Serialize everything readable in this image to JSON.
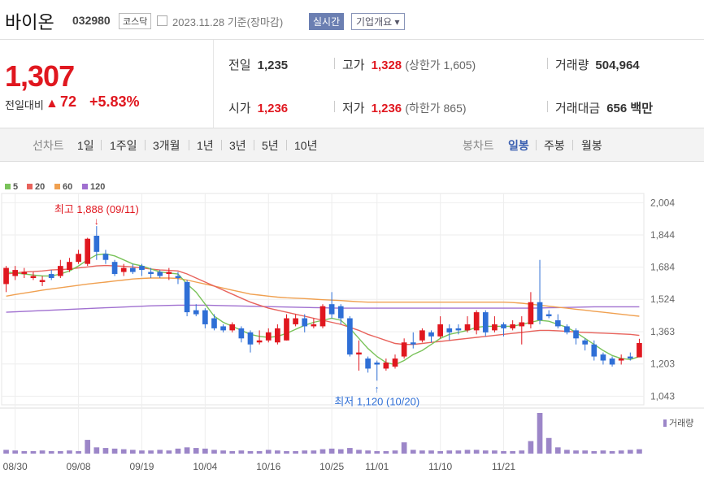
{
  "header": {
    "name": "바이온",
    "code": "032980",
    "market": "코스닥",
    "date": "2023.11.28 기준(장마감)",
    "realtime": "실시간",
    "overview": "기업개요"
  },
  "price": {
    "current": "1,307",
    "change_label": "전일대비",
    "change_value": "72",
    "change_pct": "+5.83%",
    "arrow": "▲"
  },
  "stats": {
    "prev_label": "전일",
    "prev": "1,235",
    "high_label": "고가",
    "high": "1,328",
    "upper_limit": "(상한가 1,605)",
    "volume_label": "거래량",
    "volume": "504,964",
    "open_label": "시가",
    "open": "1,236",
    "low_label": "저가",
    "low": "1,236",
    "lower_limit": "(하한가 865)",
    "amount_label": "거래대금",
    "amount": "656 백만"
  },
  "nav": {
    "line_label": "선차트",
    "periods": [
      "1일",
      "1주일",
      "3개월",
      "1년",
      "3년",
      "5년",
      "10년"
    ],
    "candle_label": "봉차트",
    "candles": [
      "일봉",
      "주봉",
      "월봉"
    ],
    "active_candle": "일봉"
  },
  "colors": {
    "up": "#e0171f",
    "down": "#2f6fd6",
    "ma5": "#7ac35a",
    "ma20": "#e8635c",
    "ma60": "#f0a050",
    "ma120": "#a070d0",
    "volume": "#9c86c8"
  },
  "chart_data": {
    "type": "candlestick",
    "legend": [
      {
        "name": "5",
        "color": "#7ac35a"
      },
      {
        "name": "20",
        "color": "#e8635c"
      },
      {
        "name": "60",
        "color": "#f0a050"
      },
      {
        "name": "120",
        "color": "#a070d0"
      }
    ],
    "ylim": [
      1000,
      2050
    ],
    "yticks": [
      "2,004",
      "1,844",
      "1,684",
      "1,524",
      "1,363",
      "1,203",
      "1,043"
    ],
    "ytick_values": [
      2004,
      1844,
      1684,
      1524,
      1363,
      1203,
      1043
    ],
    "xtick_labels": [
      "08/30",
      "09/08",
      "09/19",
      "10/04",
      "10/16",
      "10/25",
      "11/01",
      "11/10",
      "11/21"
    ],
    "xtick_index": [
      1,
      8,
      15,
      22,
      29,
      36,
      41,
      48,
      55
    ],
    "annotations": {
      "high": "최고 1,888 (09/11)",
      "low": "최저 1,120 (10/20)"
    },
    "volume_label": "거래량",
    "candles": [
      [
        1600,
        1680,
        1560,
        1690
      ],
      [
        1640,
        1670,
        1620,
        1690
      ],
      [
        1650,
        1660,
        1630,
        1680
      ],
      [
        1630,
        1640,
        1620,
        1660
      ],
      [
        1610,
        1620,
        1590,
        1640
      ],
      [
        1650,
        1630,
        1620,
        1670
      ],
      [
        1640,
        1690,
        1630,
        1720
      ],
      [
        1670,
        1710,
        1660,
        1730
      ],
      [
        1710,
        1750,
        1700,
        1770
      ],
      [
        1700,
        1825,
        1690,
        1830
      ],
      [
        1840,
        1760,
        1720,
        1888
      ],
      [
        1750,
        1720,
        1700,
        1770
      ],
      [
        1710,
        1650,
        1640,
        1720
      ],
      [
        1660,
        1680,
        1640,
        1700
      ],
      [
        1680,
        1660,
        1650,
        1700
      ],
      [
        1690,
        1670,
        1640,
        1700
      ],
      [
        1660,
        1650,
        1630,
        1680
      ],
      [
        1660,
        1640,
        1630,
        1670
      ],
      [
        1650,
        1660,
        1620,
        1680
      ],
      [
        1640,
        1630,
        1600,
        1660
      ],
      [
        1610,
        1460,
        1440,
        1620
      ],
      [
        1470,
        1450,
        1440,
        1500
      ],
      [
        1470,
        1400,
        1380,
        1480
      ],
      [
        1430,
        1380,
        1370,
        1450
      ],
      [
        1390,
        1370,
        1360,
        1400
      ],
      [
        1370,
        1400,
        1360,
        1410
      ],
      [
        1380,
        1330,
        1310,
        1390
      ],
      [
        1360,
        1300,
        1260,
        1370
      ],
      [
        1310,
        1320,
        1300,
        1370
      ],
      [
        1320,
        1360,
        1310,
        1380
      ],
      [
        1310,
        1380,
        1300,
        1400
      ],
      [
        1320,
        1430,
        1320,
        1450
      ],
      [
        1400,
        1430,
        1390,
        1450
      ],
      [
        1430,
        1390,
        1360,
        1450
      ],
      [
        1390,
        1400,
        1380,
        1430
      ],
      [
        1390,
        1490,
        1380,
        1500
      ],
      [
        1500,
        1450,
        1430,
        1560
      ],
      [
        1490,
        1430,
        1400,
        1500
      ],
      [
        1430,
        1250,
        1240,
        1440
      ],
      [
        1250,
        1260,
        1170,
        1320
      ],
      [
        1230,
        1180,
        1160,
        1240
      ],
      [
        1210,
        1200,
        1120,
        1220
      ],
      [
        1180,
        1210,
        1170,
        1230
      ],
      [
        1190,
        1230,
        1180,
        1250
      ],
      [
        1240,
        1310,
        1230,
        1330
      ],
      [
        1310,
        1300,
        1280,
        1360
      ],
      [
        1320,
        1370,
        1310,
        1380
      ],
      [
        1360,
        1340,
        1310,
        1370
      ],
      [
        1340,
        1400,
        1330,
        1440
      ],
      [
        1380,
        1360,
        1320,
        1400
      ],
      [
        1380,
        1370,
        1350,
        1400
      ],
      [
        1370,
        1400,
        1360,
        1440
      ],
      [
        1370,
        1460,
        1350,
        1470
      ],
      [
        1460,
        1360,
        1340,
        1470
      ],
      [
        1370,
        1400,
        1360,
        1440
      ],
      [
        1400,
        1380,
        1340,
        1410
      ],
      [
        1380,
        1400,
        1370,
        1420
      ],
      [
        1390,
        1410,
        1300,
        1440
      ],
      [
        1400,
        1510,
        1380,
        1560
      ],
      [
        1510,
        1420,
        1400,
        1720
      ],
      [
        1450,
        1440,
        1430,
        1470
      ],
      [
        1420,
        1390,
        1380,
        1450
      ],
      [
        1390,
        1360,
        1350,
        1400
      ],
      [
        1370,
        1330,
        1300,
        1380
      ],
      [
        1320,
        1300,
        1270,
        1330
      ],
      [
        1300,
        1240,
        1220,
        1320
      ],
      [
        1250,
        1220,
        1200,
        1260
      ],
      [
        1230,
        1200,
        1190,
        1240
      ],
      [
        1220,
        1230,
        1200,
        1250
      ],
      [
        1240,
        1230,
        1220,
        1260
      ],
      [
        1236,
        1307,
        1236,
        1328
      ]
    ],
    "ma5": [
      1660,
      1655,
      1650,
      1645,
      1640,
      1640,
      1650,
      1665,
      1690,
      1720,
      1745,
      1750,
      1740,
      1720,
      1700,
      1690,
      1675,
      1660,
      1655,
      1650,
      1600,
      1560,
      1500,
      1440,
      1410,
      1390,
      1370,
      1350,
      1340,
      1335,
      1340,
      1355,
      1375,
      1395,
      1410,
      1420,
      1430,
      1420,
      1380,
      1330,
      1280,
      1240,
      1210,
      1200,
      1220,
      1250,
      1270,
      1300,
      1330,
      1350,
      1360,
      1370,
      1385,
      1390,
      1390,
      1390,
      1390,
      1400,
      1410,
      1420,
      1415,
      1400,
      1385,
      1360,
      1330,
      1300,
      1270,
      1245,
      1230,
      1225,
      1240
    ],
    "ma20": [
      1650,
      1655,
      1660,
      1662,
      1665,
      1670,
      1672,
      1675,
      1680,
      1685,
      1690,
      1692,
      1690,
      1688,
      1685,
      1680,
      1675,
      1670,
      1668,
      1665,
      1650,
      1630,
      1610,
      1590,
      1570,
      1550,
      1530,
      1510,
      1495,
      1480,
      1470,
      1460,
      1450,
      1440,
      1430,
      1420,
      1410,
      1400,
      1385,
      1370,
      1350,
      1335,
      1320,
      1305,
      1300,
      1300,
      1305,
      1310,
      1315,
      1320,
      1325,
      1330,
      1335,
      1340,
      1345,
      1350,
      1355,
      1360,
      1365,
      1370,
      1370,
      1368,
      1365,
      1362,
      1360,
      1358,
      1356,
      1354,
      1352,
      1350,
      1345
    ],
    "ma60": [
      1540,
      1548,
      1555,
      1562,
      1570,
      1576,
      1582,
      1588,
      1594,
      1600,
      1605,
      1610,
      1615,
      1620,
      1625,
      1628,
      1630,
      1630,
      1630,
      1628,
      1620,
      1610,
      1600,
      1590,
      1580,
      1570,
      1560,
      1550,
      1545,
      1540,
      1535,
      1532,
      1530,
      1528,
      1525,
      1522,
      1520,
      1518,
      1515,
      1512,
      1510,
      1510,
      1510,
      1510,
      1510,
      1510,
      1510,
      1510,
      1510,
      1510,
      1510,
      1510,
      1510,
      1510,
      1510,
      1510,
      1508,
      1505,
      1500,
      1495,
      1490,
      1485,
      1480,
      1475,
      1470,
      1465,
      1460,
      1455,
      1450,
      1445,
      1440
    ],
    "ma120": [
      1460,
      1462,
      1464,
      1466,
      1468,
      1470,
      1472,
      1474,
      1476,
      1478,
      1480,
      1482,
      1484,
      1486,
      1488,
      1490,
      1492,
      1493,
      1494,
      1495,
      1495,
      1495,
      1495,
      1494,
      1493,
      1492,
      1491,
      1490,
      1489,
      1488,
      1487,
      1486,
      1485,
      1484,
      1483,
      1482,
      1481,
      1480,
      1480,
      1480,
      1480,
      1480,
      1480,
      1480,
      1480,
      1480,
      1480,
      1480,
      1480,
      1480,
      1480,
      1480,
      1480,
      1480,
      1480,
      1480,
      1480,
      1480,
      1480,
      1481,
      1482,
      1483,
      1484,
      1485,
      1486,
      1487,
      1487,
      1487,
      1487,
      1487,
      1487
    ],
    "volume": [
      6,
      5,
      4,
      4,
      5,
      4,
      4,
      5,
      4,
      22,
      10,
      9,
      8,
      7,
      6,
      5,
      5,
      6,
      5,
      8,
      10,
      9,
      8,
      6,
      5,
      4,
      5,
      4,
      4,
      6,
      5,
      4,
      4,
      5,
      5,
      7,
      8,
      7,
      9,
      6,
      5,
      4,
      4,
      5,
      18,
      6,
      5,
      5,
      4,
      5,
      5,
      6,
      6,
      5,
      5,
      4,
      4,
      5,
      20,
      65,
      25,
      10,
      6,
      5,
      5,
      4,
      5,
      4,
      5,
      6,
      7
    ]
  }
}
